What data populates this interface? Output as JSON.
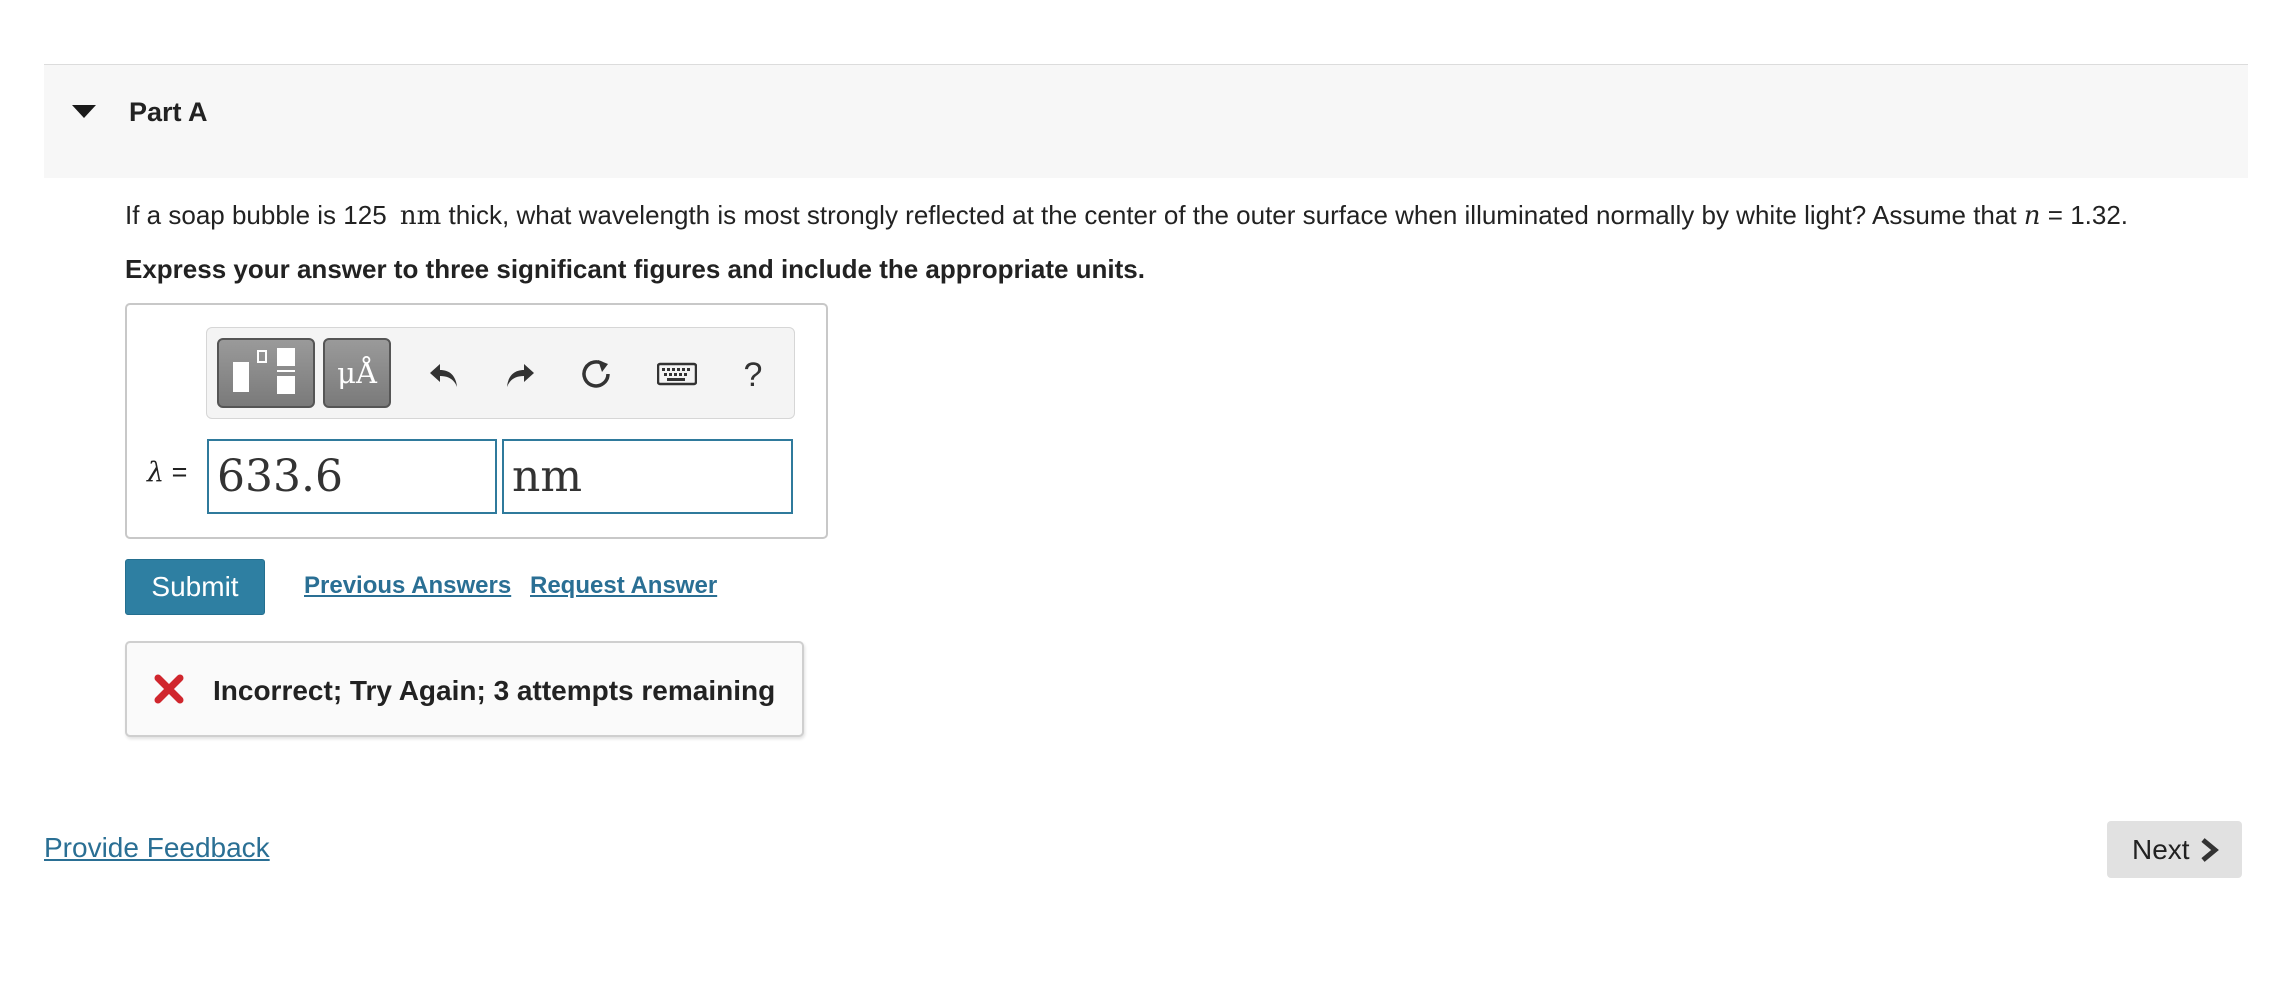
{
  "part": {
    "title": "Part A"
  },
  "question": {
    "text_before_value": "If a soap bubble is",
    "thickness_value": "125",
    "thickness_unit": "nm",
    "text_after_unit": "thick, what wavelength is most strongly reflected at the center of the outer surface when illuminated normally by white light? Assume that",
    "index_symbol": "n",
    "index_equals": "= 1.32."
  },
  "instruction": "Express your answer to three significant figures and include the appropriate units.",
  "toolbar": {
    "units_label": "μÅ",
    "help_label": "?"
  },
  "answer": {
    "variable_symbol": "λ",
    "equals": "=",
    "value": "633.6",
    "unit": "nm"
  },
  "actions": {
    "submit_label": "Submit",
    "previous_answers_label": "Previous Answers",
    "request_answer_label": "Request Answer"
  },
  "feedback": {
    "message": "Incorrect; Try Again; 3 attempts remaining",
    "status_color": "#d0262d"
  },
  "footer": {
    "provide_feedback_label": "Provide Feedback",
    "next_label": "Next"
  },
  "colors": {
    "accent": "#2e7fa2",
    "link": "#2a6f94"
  }
}
